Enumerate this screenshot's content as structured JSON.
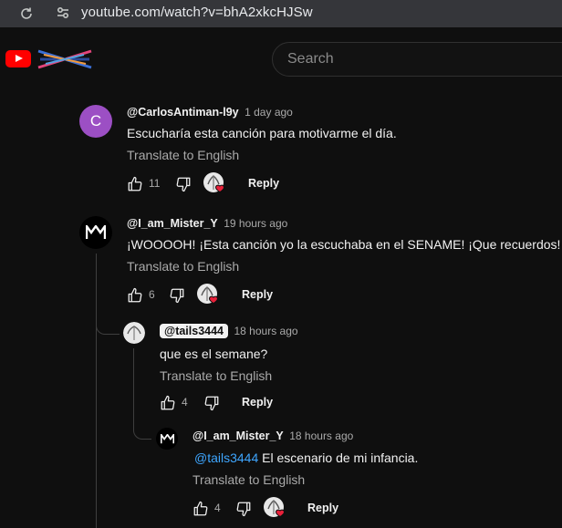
{
  "browser": {
    "url": "youtube.com/watch?v=bhA2xkcHJSw"
  },
  "header": {
    "search_placeholder": "Search"
  },
  "comments": [
    {
      "author": "@CarlosAntiman-l9y",
      "time": "1 day ago",
      "avatar_letter": "C",
      "avatar_color": "#9c4fc4",
      "text": "Escucharía esta canción para motivarme el día.",
      "translate": "Translate to English",
      "likes": "11",
      "reply_label": "Reply"
    },
    {
      "author": "@I_am_Mister_Y",
      "time": "19 hours ago",
      "text": "¡WOOOOH! ¡Esta canción yo la escuchaba en el SENAME! ¡Que recuerdos!",
      "translate": "Translate to English",
      "likes": "6",
      "reply_label": "Reply",
      "replies": [
        {
          "author": "@tails3444",
          "time": "18 hours ago",
          "text": "que es el semane?",
          "translate": "Translate to English",
          "likes": "4",
          "reply_label": "Reply"
        },
        {
          "author": "@I_am_Mister_Y",
          "time": "18 hours ago",
          "mention": "@tails3444",
          "text": " El escenario de mi infancia.",
          "translate": "Translate to English",
          "likes": "4",
          "reply_label": "Reply"
        }
      ]
    }
  ],
  "colors": {
    "accent_link": "#3ea6ff",
    "brand_red": "#ff0000",
    "heart": "#e8213a"
  },
  "icons": [
    "reload-icon",
    "site-info-icon",
    "youtube-logo-icon",
    "like-icon",
    "dislike-icon",
    "creator-heart-icon"
  ]
}
